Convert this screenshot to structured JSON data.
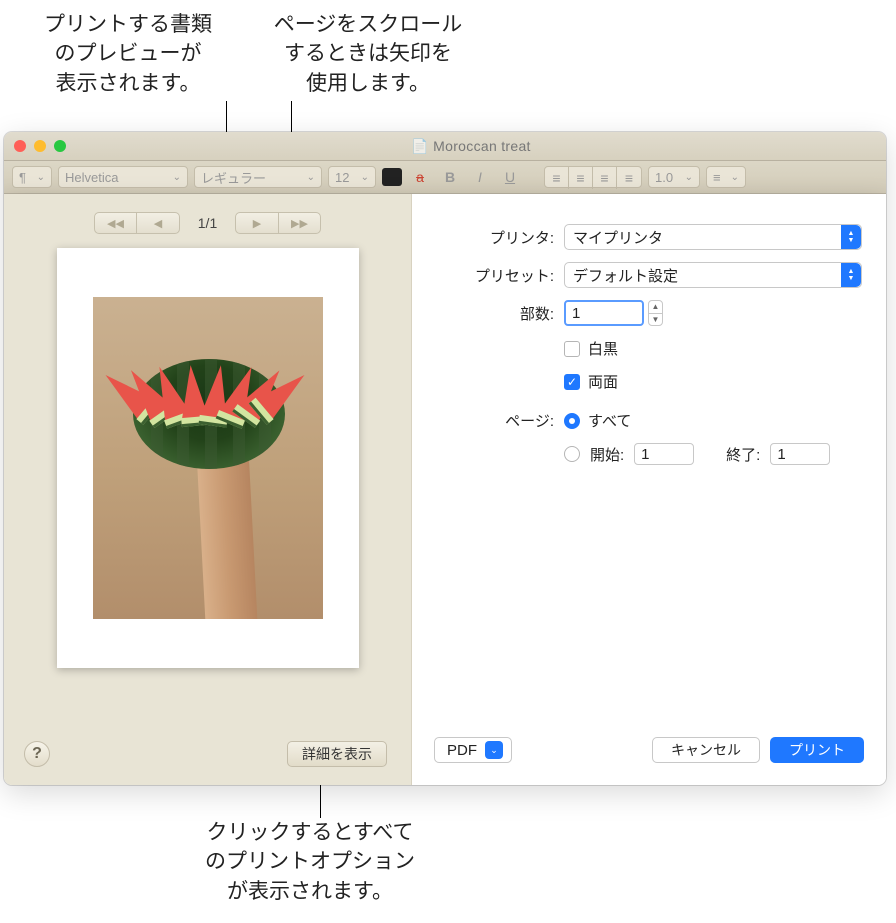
{
  "callouts": {
    "preview": "プリントする書類\nのプレビューが\n表示されます。",
    "arrows": "ページをスクロール\nするときは矢印を\n使用します。",
    "details": "クリックするとすべて\nのプリントオプション\nが表示されます。"
  },
  "window": {
    "title": "Moroccan treat"
  },
  "toolbar": {
    "font": "Helvetica",
    "style": "レギュラー",
    "size": "12",
    "lineSpacing": "1.0"
  },
  "preview": {
    "pageIndicator": "1/1",
    "detailsButton": "詳細を表示"
  },
  "print": {
    "printerLabel": "プリンタ:",
    "printerValue": "マイプリンタ",
    "presetLabel": "プリセット:",
    "presetValue": "デフォルト設定",
    "copiesLabel": "部数:",
    "copiesValue": "1",
    "bwLabel": "白黒",
    "duplexLabel": "両面",
    "pagesLabel": "ページ:",
    "allLabel": "すべて",
    "fromLabel": "開始:",
    "fromValue": "1",
    "toLabel": "終了:",
    "toValue": "1",
    "pdfLabel": "PDF",
    "cancel": "キャンセル",
    "submit": "プリント"
  }
}
